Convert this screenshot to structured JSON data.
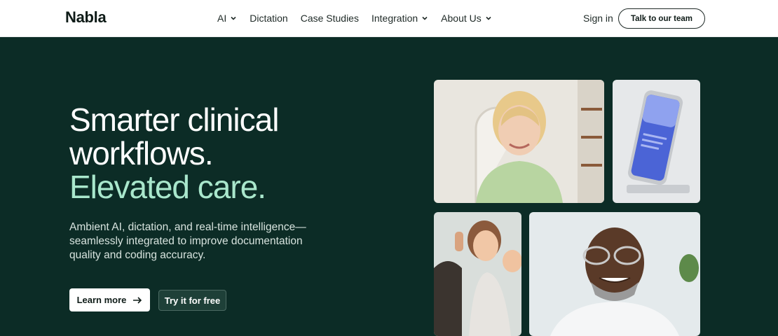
{
  "header": {
    "logo": "Nabla",
    "nav": [
      {
        "label": "AI",
        "has_dropdown": true
      },
      {
        "label": "Dictation",
        "has_dropdown": false
      },
      {
        "label": "Case Studies",
        "has_dropdown": false
      },
      {
        "label": "Integration",
        "has_dropdown": true
      },
      {
        "label": "About Us",
        "has_dropdown": true
      }
    ],
    "sign_in": "Sign in",
    "cta": "Talk to our team"
  },
  "hero": {
    "headline_line1": "Smarter clinical",
    "headline_line2": "workflows.",
    "headline_accent": "Elevated care.",
    "subtext": "Ambient AI, dictation, and real-time intelligence—seamlessly integrated to improve documentation quality and coding accuracy.",
    "primary_button": "Learn more",
    "secondary_button": "Try it for free",
    "images": [
      "smiling-woman-photo",
      "phone-on-stand-photo",
      "family-high-five-photo",
      "smiling-doctor-photo"
    ]
  },
  "colors": {
    "hero_background": "#0c2c26",
    "accent_text": "#a9e7cc",
    "header_background": "#ffffff"
  }
}
